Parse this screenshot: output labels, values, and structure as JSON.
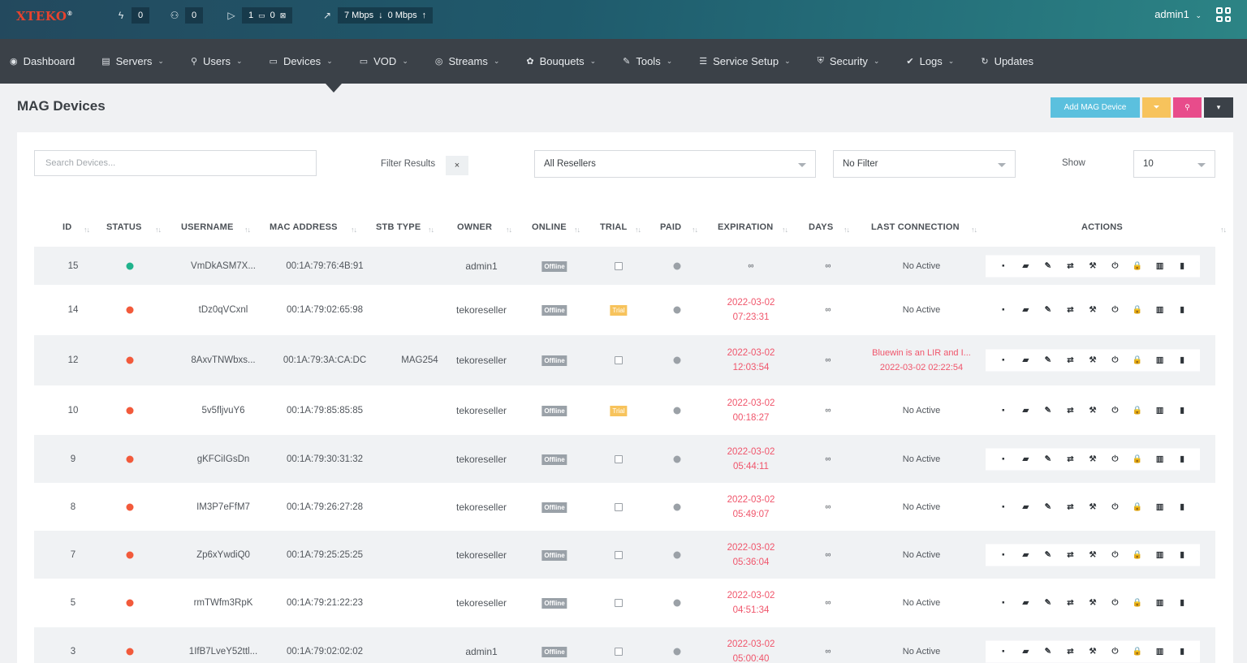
{
  "topbar": {
    "logo": "XTEKO",
    "stats": [
      {
        "icon": "bolt-icon",
        "glyph": "ϟ",
        "value": "0"
      },
      {
        "icon": "users-icon",
        "glyph": "⚇",
        "value": "0"
      },
      {
        "icon": "play-icon",
        "glyph": "▷",
        "parts": [
          "1",
          "0"
        ]
      },
      {
        "icon": "trend-icon",
        "glyph": "↗",
        "down": "7 Mbps",
        "up": "0 Mbps"
      }
    ],
    "user": "admin1"
  },
  "nav": [
    {
      "label": "Dashboard",
      "icon": "dashboard-icon",
      "glyph": "◉",
      "dropdown": false
    },
    {
      "label": "Servers",
      "icon": "servers-icon",
      "glyph": "▤",
      "dropdown": true
    },
    {
      "label": "Users",
      "icon": "user-icon",
      "glyph": "⚲",
      "dropdown": true
    },
    {
      "label": "Devices",
      "icon": "devices-icon",
      "glyph": "▭",
      "dropdown": true
    },
    {
      "label": "VOD",
      "icon": "vod-icon",
      "glyph": "▭",
      "dropdown": true
    },
    {
      "label": "Streams",
      "icon": "streams-icon",
      "glyph": "◎",
      "dropdown": true
    },
    {
      "label": "Bouquets",
      "icon": "bouquets-icon",
      "glyph": "✿",
      "dropdown": true
    },
    {
      "label": "Tools",
      "icon": "tools-icon",
      "glyph": "✎",
      "dropdown": true
    },
    {
      "label": "Service Setup",
      "icon": "setup-icon",
      "glyph": "☰",
      "dropdown": true
    },
    {
      "label": "Security",
      "icon": "shield-icon",
      "glyph": "⛨",
      "dropdown": true
    },
    {
      "label": "Logs",
      "icon": "logs-icon",
      "glyph": "✔",
      "dropdown": true
    },
    {
      "label": "Updates",
      "icon": "updates-icon",
      "glyph": "↻",
      "dropdown": false
    }
  ],
  "page": {
    "title": "MAG Devices",
    "add_button": "Add MAG Device"
  },
  "filters": {
    "search_placeholder": "Search Devices...",
    "filter_results": "Filter Results",
    "clear": "×",
    "resellers": "All Resellers",
    "filter": "No Filter",
    "show_label": "Show",
    "show_value": "10"
  },
  "columns": [
    "ID",
    "STATUS",
    "USERNAME",
    "MAC ADDRESS",
    "STB TYPE",
    "OWNER",
    "ONLINE",
    "TRIAL",
    "PAID",
    "EXPIRATION",
    "DAYS",
    "LAST CONNECTION",
    "ACTIONS"
  ],
  "rows": [
    {
      "id": "15",
      "status": "green",
      "username": "VmDkASM7X...",
      "mac": "00:1A:79:76:4B:91",
      "stb": "",
      "owner": "admin1",
      "online": "Offline",
      "trial": false,
      "exp_date": "∞",
      "exp_time": "",
      "days": "∞",
      "last1": "No Active",
      "last2": ""
    },
    {
      "id": "14",
      "status": "red",
      "username": "tDz0qVCxnl",
      "mac": "00:1A:79:02:65:98",
      "stb": "",
      "owner": "tekoreseller",
      "online": "Offline",
      "trial": true,
      "exp_date": "2022-03-02",
      "exp_time": "07:23:31",
      "days": "∞",
      "last1": "No Active",
      "last2": ""
    },
    {
      "id": "12",
      "status": "red",
      "username": "8AxvTNWbxs...",
      "mac": "00:1A:79:3A:CA:DC",
      "stb": "MAG254",
      "owner": "tekoreseller",
      "online": "Offline",
      "trial": false,
      "exp_date": "2022-03-02",
      "exp_time": "12:03:54",
      "days": "∞",
      "last1": "Bluewin is an LIR and I...",
      "last2": "2022-03-02 02:22:54"
    },
    {
      "id": "10",
      "status": "red",
      "username": "5v5fljvuY6",
      "mac": "00:1A:79:85:85:85",
      "stb": "",
      "owner": "tekoreseller",
      "online": "Offline",
      "trial": true,
      "exp_date": "2022-03-02",
      "exp_time": "00:18:27",
      "days": "∞",
      "last1": "No Active",
      "last2": ""
    },
    {
      "id": "9",
      "status": "red",
      "username": "gKFCiIGsDn",
      "mac": "00:1A:79:30:31:32",
      "stb": "",
      "owner": "tekoreseller",
      "online": "Offline",
      "trial": false,
      "exp_date": "2022-03-02",
      "exp_time": "05:44:11",
      "days": "∞",
      "last1": "No Active",
      "last2": ""
    },
    {
      "id": "8",
      "status": "red",
      "username": "IM3P7eFfM7",
      "mac": "00:1A:79:26:27:28",
      "stb": "",
      "owner": "tekoreseller",
      "online": "Offline",
      "trial": false,
      "exp_date": "2022-03-02",
      "exp_time": "05:49:07",
      "days": "∞",
      "last1": "No Active",
      "last2": ""
    },
    {
      "id": "7",
      "status": "red",
      "username": "Zp6xYwdiQ0",
      "mac": "00:1A:79:25:25:25",
      "stb": "",
      "owner": "tekoreseller",
      "online": "Offline",
      "trial": false,
      "exp_date": "2022-03-02",
      "exp_time": "05:36:04",
      "days": "∞",
      "last1": "No Active",
      "last2": ""
    },
    {
      "id": "5",
      "status": "red",
      "username": "rmTWfm3RpK",
      "mac": "00:1A:79:21:22:23",
      "stb": "",
      "owner": "tekoreseller",
      "online": "Offline",
      "trial": false,
      "exp_date": "2022-03-02",
      "exp_time": "04:51:34",
      "days": "∞",
      "last1": "No Active",
      "last2": ""
    },
    {
      "id": "3",
      "status": "red",
      "username": "1IfB7LveY52ttl...",
      "mac": "00:1A:79:02:02:02",
      "stb": "",
      "owner": "admin1",
      "online": "Offline",
      "trial": false,
      "exp_date": "2022-03-02",
      "exp_time": "05:00:40",
      "days": "∞",
      "last1": "No Active",
      "last2": ""
    }
  ],
  "trial_label": "Trial",
  "action_icons": [
    {
      "name": "info-icon",
      "glyph": "▪"
    },
    {
      "name": "message-icon",
      "glyph": "▰"
    },
    {
      "name": "edit-icon",
      "glyph": "✎"
    },
    {
      "name": "convert-icon",
      "glyph": "⇄"
    },
    {
      "name": "hammer-icon",
      "glyph": "⚒"
    },
    {
      "name": "power-icon",
      "glyph": "⏻"
    },
    {
      "name": "lock-icon",
      "glyph": "🔒"
    },
    {
      "name": "stats-icon",
      "glyph": "▥"
    },
    {
      "name": "delete-icon",
      "glyph": "▮"
    }
  ]
}
